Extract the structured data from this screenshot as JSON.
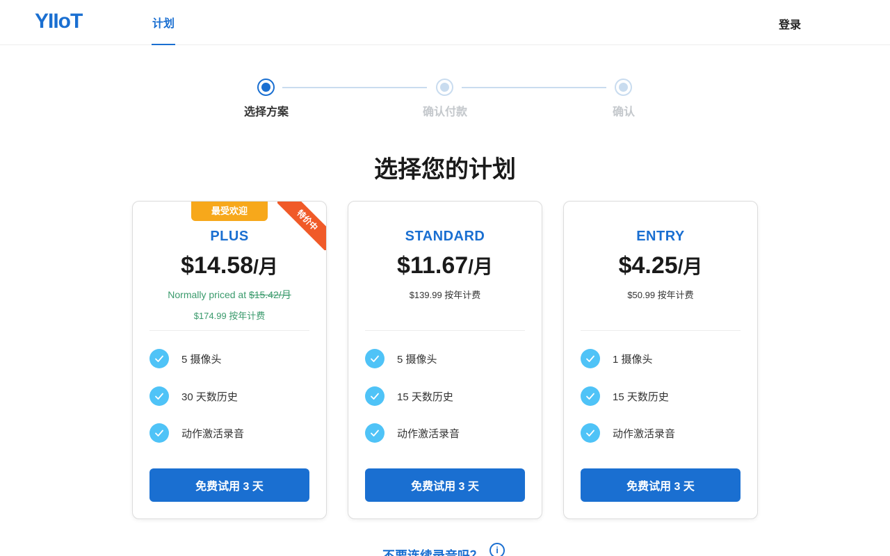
{
  "header": {
    "logo": "YIIoT",
    "nav_tab": "计划",
    "login": "登录"
  },
  "stepper": {
    "steps": [
      {
        "label": "选择方案",
        "state": "active"
      },
      {
        "label": "确认付款",
        "state": "inactive"
      },
      {
        "label": "确认",
        "state": "inactive"
      }
    ]
  },
  "title": "选择您的计划",
  "plans": [
    {
      "name": "PLUS",
      "badge": "最受欢迎",
      "ribbon": "特价中",
      "price": "$14.58",
      "unit": "/月",
      "normal_prefix": "Normally priced at ",
      "normal_price": "$15.42/月",
      "annual": "$174.99 按年计费",
      "features": [
        "5 摄像头",
        "30 天数历史",
        "动作激活录音"
      ],
      "button": "免费试用 3 天"
    },
    {
      "name": "STANDARD",
      "price": "$11.67",
      "unit": "/月",
      "annual": "$139.99 按年计费",
      "features": [
        "5 摄像头",
        "15 天数历史",
        "动作激活录音"
      ],
      "button": "免费试用 3 天"
    },
    {
      "name": "ENTRY",
      "price": "$4.25",
      "unit": "/月",
      "annual": "$50.99 按年计费",
      "features": [
        "1 摄像头",
        "15 天数历史",
        "动作激活录音"
      ],
      "button": "免费试用 3 天"
    }
  ],
  "bottom": {
    "link": "不要连续录音吗？",
    "info_icon": "i"
  },
  "colors": {
    "accent": "#1a6fd1",
    "check": "#4fc3f7",
    "badge": "#f7a81b",
    "ribbon": "#f05a28",
    "green_text": "#3a9a6c"
  }
}
